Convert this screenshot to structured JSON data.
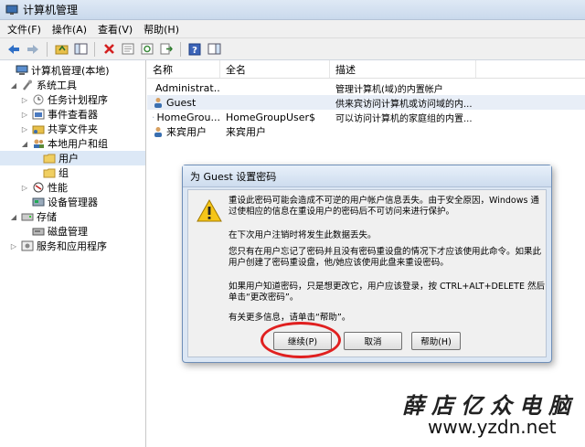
{
  "window": {
    "title": "计算机管理"
  },
  "menu": [
    "文件(F)",
    "操作(A)",
    "查看(V)",
    "帮助(H)"
  ],
  "tree": [
    {
      "label": "计算机管理(本地)",
      "level": 0,
      "icon": "computer-icon"
    },
    {
      "label": "系统工具",
      "level": 1,
      "icon": "tools-icon"
    },
    {
      "label": "任务计划程序",
      "level": 2,
      "icon": "clock-icon"
    },
    {
      "label": "事件查看器",
      "level": 2,
      "icon": "event-viewer-icon"
    },
    {
      "label": "共享文件夹",
      "level": 2,
      "icon": "shared-folder-icon"
    },
    {
      "label": "本地用户和组",
      "level": 2,
      "icon": "users-icon"
    },
    {
      "label": "用户",
      "level": 3,
      "icon": "folder-icon"
    },
    {
      "label": "组",
      "level": 3,
      "icon": "folder-icon"
    },
    {
      "label": "性能",
      "level": 2,
      "icon": "performance-icon"
    },
    {
      "label": "设备管理器",
      "level": 2,
      "icon": "device-manager-icon"
    },
    {
      "label": "存储",
      "level": 1,
      "icon": "storage-icon"
    },
    {
      "label": "磁盘管理",
      "level": 2,
      "icon": "disk-icon"
    },
    {
      "label": "服务和应用程序",
      "level": 1,
      "icon": "services-icon"
    }
  ],
  "list": {
    "headers": [
      "名称",
      "全名",
      "描述"
    ],
    "rows": [
      {
        "name": "Administrat...",
        "fullname": "",
        "desc": "管理计算机(域)的内置帐户"
      },
      {
        "name": "Guest",
        "fullname": "",
        "desc": "供来宾访问计算机或访问域的内..."
      },
      {
        "name": "HomeGrou...",
        "fullname": "HomeGroupUser$",
        "desc": "可以访问计算机的家庭组的内置..."
      },
      {
        "name": "来宾用户",
        "fullname": "来宾用户",
        "desc": ""
      }
    ]
  },
  "dialog": {
    "title": "为 Guest 设置密码",
    "p1": "重设此密码可能会造成不可逆的用户帐户信息丢失。由于安全原因，Windows 通过使相应的信息在重设用户的密码后不可访问来进行保护。",
    "p2": "在下次用户注销时将发生此数据丢失。",
    "p3": "您只有在用户忘记了密码并且没有密码重设盘的情况下才应该使用此命令。如果此用户创建了密码重设盘，他/她应该使用此盘来重设密码。",
    "p4": "如果用户知道密码，只是想更改它，用户应该登录，按 CTRL+ALT+DELETE 然后单击“更改密码”。",
    "p5": "有关更多信息，请单击“帮助”。",
    "continue": "继续(P)",
    "cancel": "取消",
    "help": "帮助(H)"
  },
  "watermark": {
    "line1": "薛店亿众电脑",
    "line2": "www.yzdn.net"
  }
}
